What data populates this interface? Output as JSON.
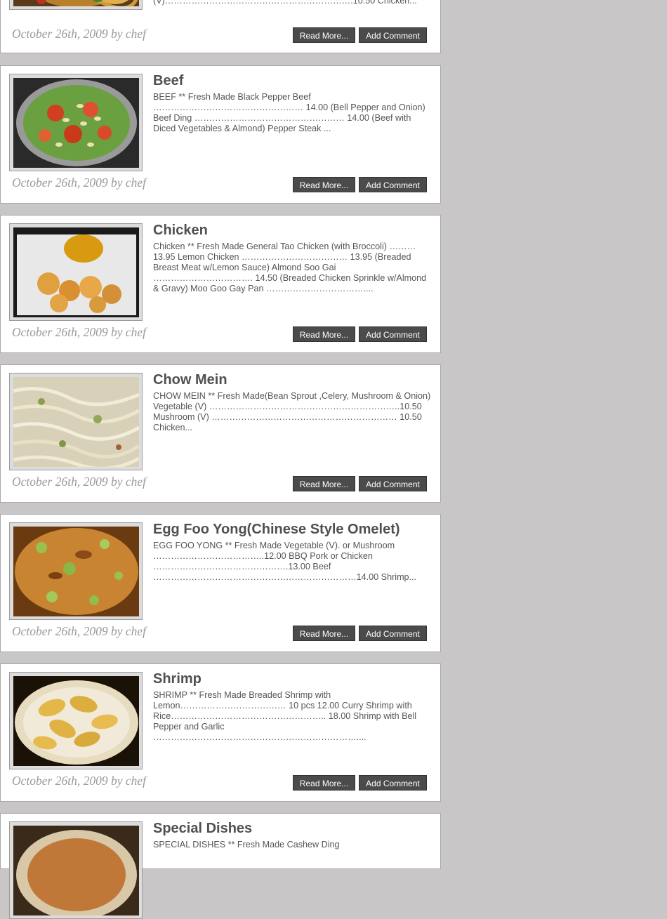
{
  "posts": [
    {
      "title": "",
      "excerpt": "(V)……………………………………………………….10.50 Chicken...",
      "meta": "October 26th, 2009 by chef",
      "read_more": "Read More...",
      "add_comment": "Add Comment",
      "image": "noodle-dish-image"
    },
    {
      "title": "Beef",
      "excerpt": "BEEF  ** Fresh Made Black Pepper Beef …………………………………………… 14.00 (Bell Pepper and Onion) Beef Ding             …………………………………………… 14.00 (Beef with Diced Vegetables & Almond) Pepper Steak ...",
      "meta": "October 26th, 2009 by chef",
      "read_more": "Read More...",
      "add_comment": "Add Comment",
      "image": "beef-dish-image"
    },
    {
      "title": "Chicken",
      "excerpt": "Chicken  ** Fresh Made General Tao Chicken (with Broccoli) ……… 13.95 Lemon Chicken ……………………………… 13.95 (Breaded Breast Meat w/Lemon Sauce) Almond Soo Gai ……………………………. 14.50 (Breaded Chicken Sprinkle w/Almond & Gravy) Moo Goo Gay Pan ……………………………....",
      "meta": "October 26th, 2009 by chef",
      "read_more": "Read More...",
      "add_comment": "Add Comment",
      "image": "chicken-dish-image"
    },
    {
      "title": "Chow Mein",
      "excerpt": "CHOW MEIN  ** Fresh Made(Bean Sprout ,Celery, Mushroom & Onion) Vegetable (V) ………………………………………………………..10.50 Mushroom (V) ……………………………………………………… 10.50 Chicken...",
      "meta": "October 26th, 2009 by chef",
      "read_more": "Read More...",
      "add_comment": "Add Comment",
      "image": "chow-mein-image"
    },
    {
      "title": "Egg Foo Yong(Chinese Style Omelet)",
      "excerpt": "EGG FOO YONG  ** Fresh Made Vegetable (V). or Mushroom ………………………………..12.00 BBQ Pork or Chicken ……………………………………….13.00 Beef ……………………………………………………………14.00 Shrimp...",
      "meta": "October 26th, 2009 by chef",
      "read_more": "Read More...",
      "add_comment": "Add Comment",
      "image": "egg-foo-yong-image"
    },
    {
      "title": "Shrimp",
      "excerpt": "SHRIMP  ** Fresh Made Breaded Shrimp with Lemon……………………………… 10 pcs 12.00 Curry Shrimp with Rice…………………………………………….. 18.00 Shrimp with Bell Pepper and Garlic ……………………………………………………………....",
      "meta": "October 26th, 2009 by chef",
      "read_more": "Read More...",
      "add_comment": "Add Comment",
      "image": "shrimp-dish-image"
    },
    {
      "title": "Special Dishes",
      "excerpt": "SPECIAL DISHES ** Fresh Made Cashew Ding",
      "meta": "",
      "read_more": "",
      "add_comment": "",
      "image": "special-dish-image"
    }
  ]
}
